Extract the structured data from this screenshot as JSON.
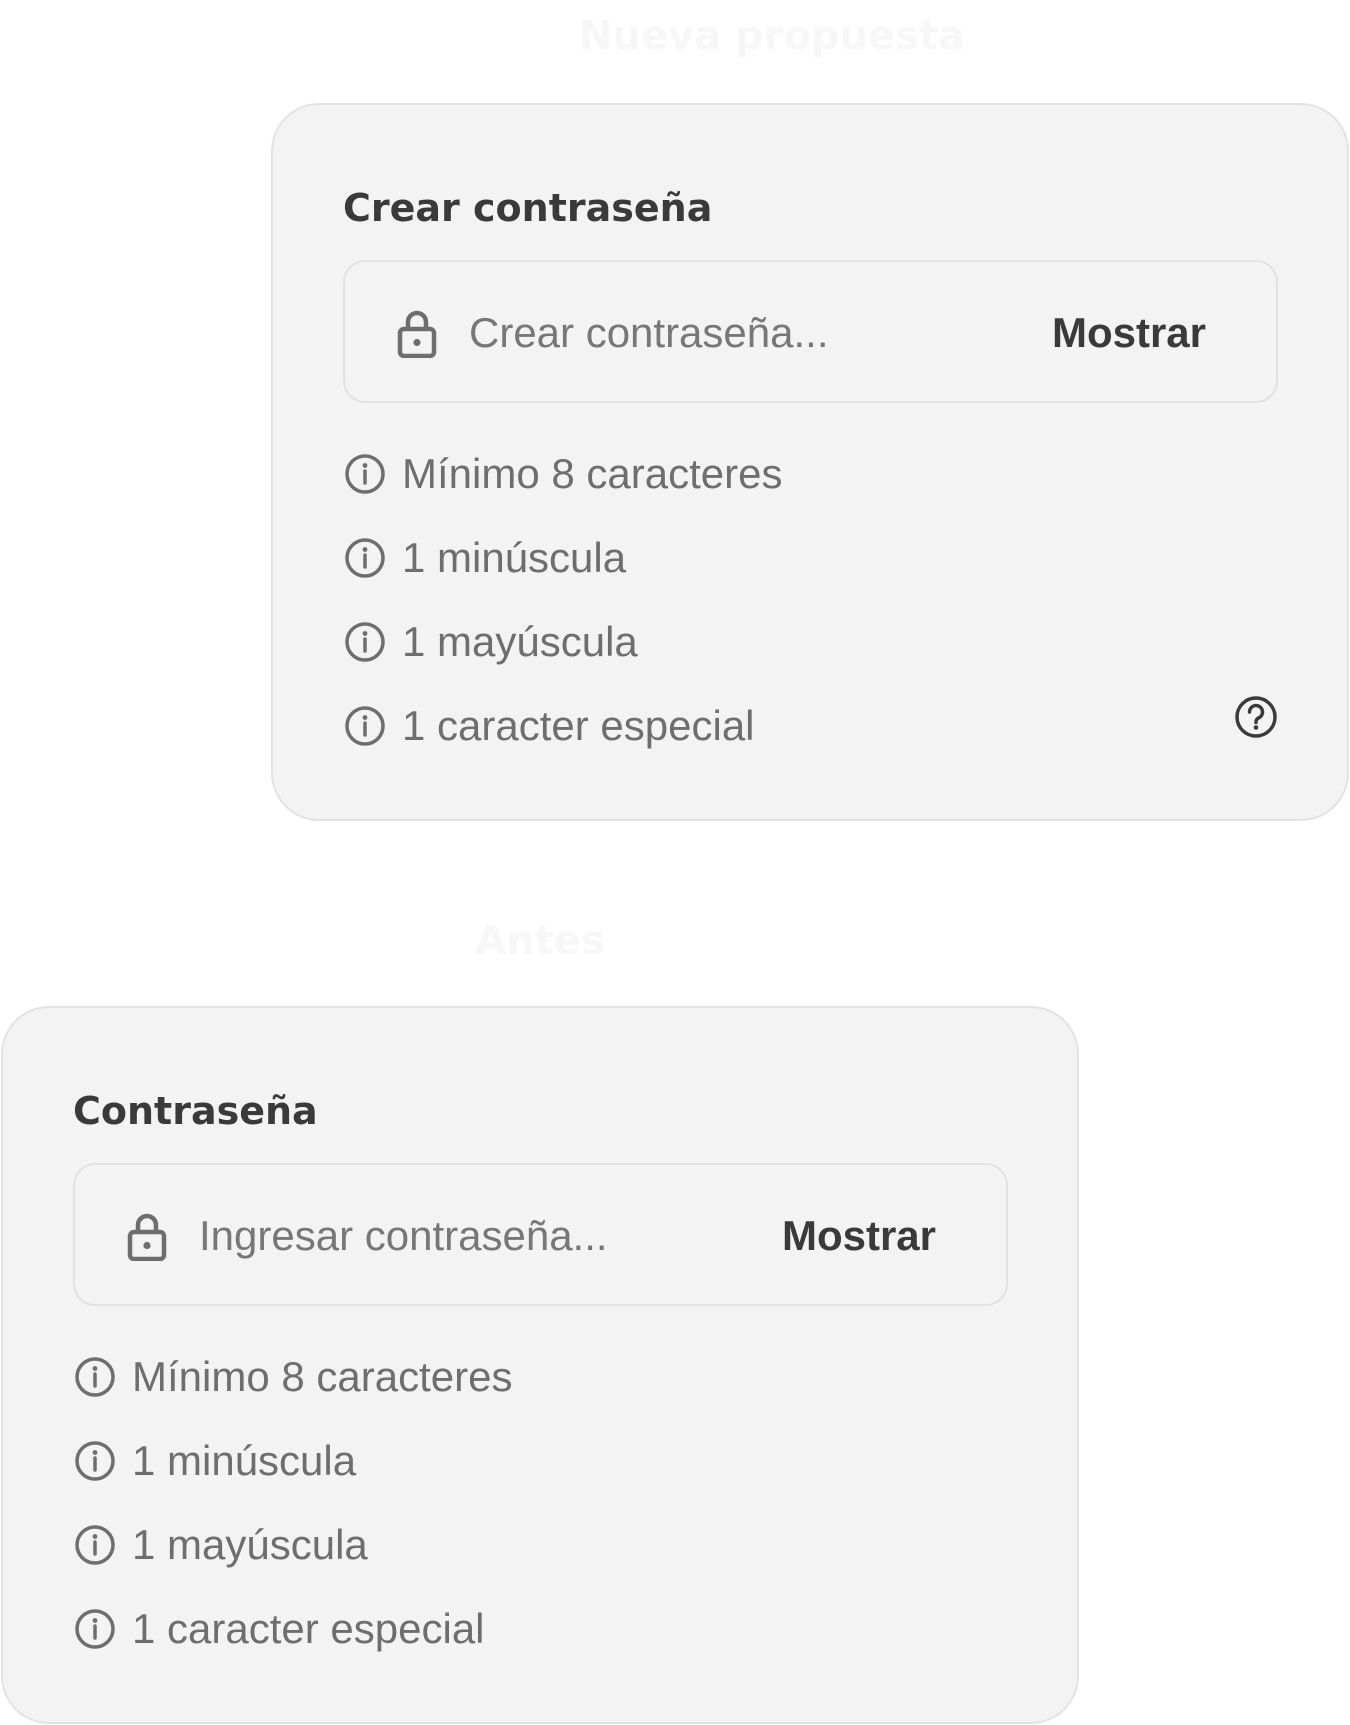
{
  "proposal": {
    "heading": "Nueva propuesta",
    "card": {
      "title": "Crear contraseña",
      "password_field": {
        "value": "",
        "placeholder": "Crear contraseña...",
        "lock_icon": "lock-icon",
        "show_label": "Mostrar"
      },
      "requirements": [
        {
          "icon": "info-icon",
          "text": "Mínimo 8 caracteres"
        },
        {
          "icon": "info-icon",
          "text": "1 minúscula"
        },
        {
          "icon": "info-icon",
          "text": "1 mayúscula"
        },
        {
          "icon": "info-icon",
          "text": "1 caracter especial"
        }
      ],
      "help_icon": "help-icon"
    }
  },
  "before": {
    "heading": "Antes",
    "card": {
      "title": "Contraseña",
      "password_field": {
        "value": "",
        "placeholder": "Ingresar contraseña...",
        "lock_icon": "lock-icon",
        "show_label": "Mostrar"
      },
      "requirements": [
        {
          "icon": "info-icon",
          "text": "Mínimo 8 caracteres"
        },
        {
          "icon": "info-icon",
          "text": "1 minúscula"
        },
        {
          "icon": "info-icon",
          "text": "1 mayúscula"
        },
        {
          "icon": "info-icon",
          "text": "1 caracter especial"
        }
      ]
    }
  },
  "colors": {
    "page_background": "#ffffff",
    "heading_text": "#f7f7f7",
    "card_background": "#f3f3f3",
    "card_border": "#e3e3e3",
    "title_text": "#3a3a3a",
    "placeholder_text": "#777777",
    "requirement_text": "#6e6e6e",
    "icon_stroke": "#6e6e6e"
  }
}
